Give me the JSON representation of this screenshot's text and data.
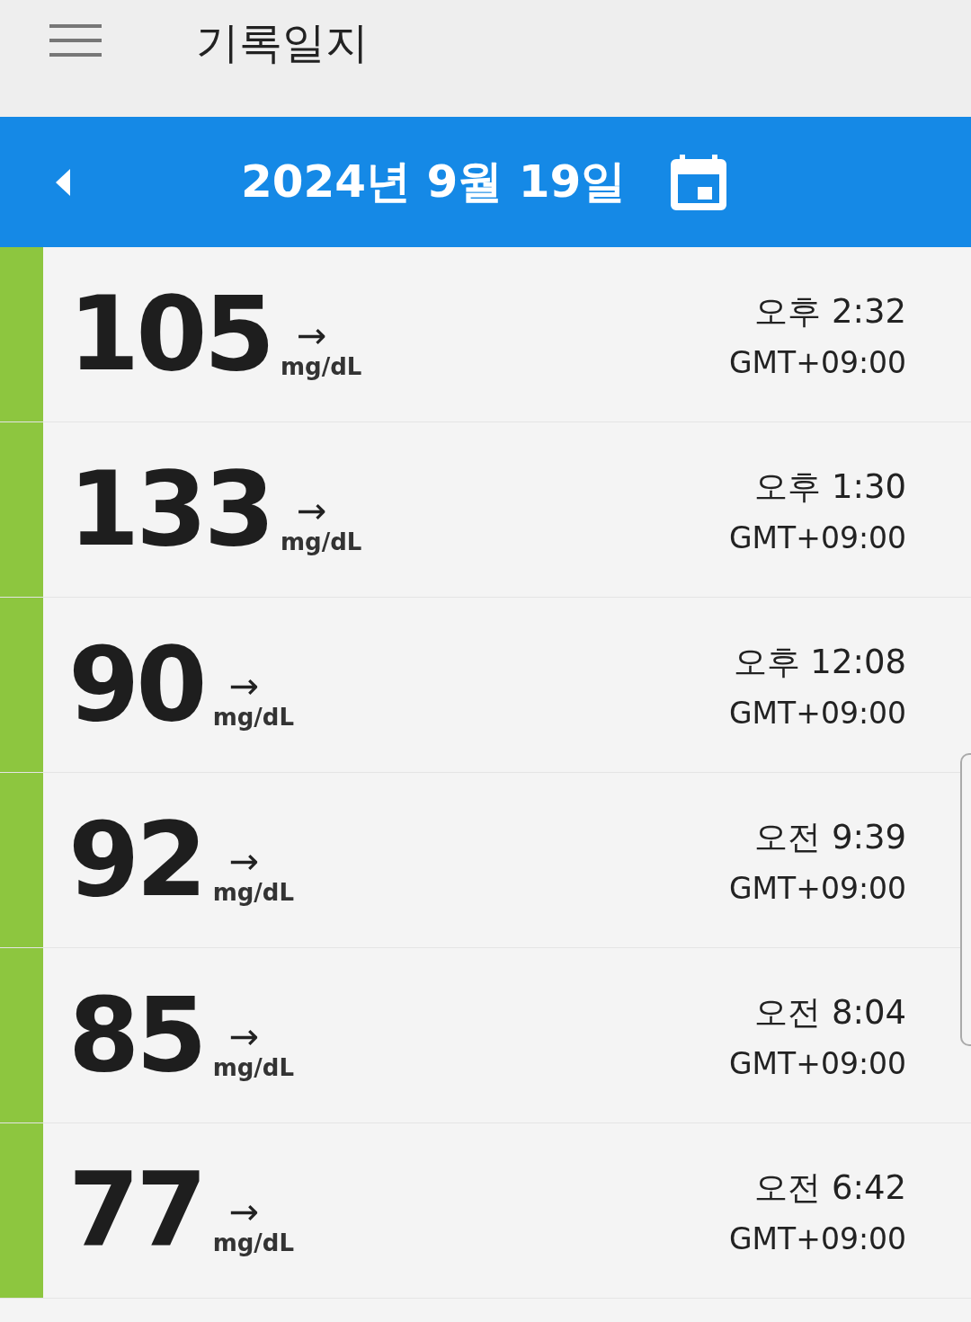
{
  "header": {
    "title": "기록일지"
  },
  "date_bar": {
    "date": "2024년 9월 19일"
  },
  "readings": [
    {
      "value": "105",
      "arrow": "→",
      "unit": "mg/dL",
      "time": "오후 2:32",
      "timezone": "GMT+09:00"
    },
    {
      "value": "133",
      "arrow": "→",
      "unit": "mg/dL",
      "time": "오후 1:30",
      "timezone": "GMT+09:00"
    },
    {
      "value": "90",
      "arrow": "→",
      "unit": "mg/dL",
      "time": "오후 12:08",
      "timezone": "GMT+09:00"
    },
    {
      "value": "92",
      "arrow": "→",
      "unit": "mg/dL",
      "time": "오전 9:39",
      "timezone": "GMT+09:00"
    },
    {
      "value": "85",
      "arrow": "→",
      "unit": "mg/dL",
      "time": "오전 8:04",
      "timezone": "GMT+09:00"
    },
    {
      "value": "77",
      "arrow": "→",
      "unit": "mg/dL",
      "time": "오전 6:42",
      "timezone": "GMT+09:00"
    }
  ]
}
